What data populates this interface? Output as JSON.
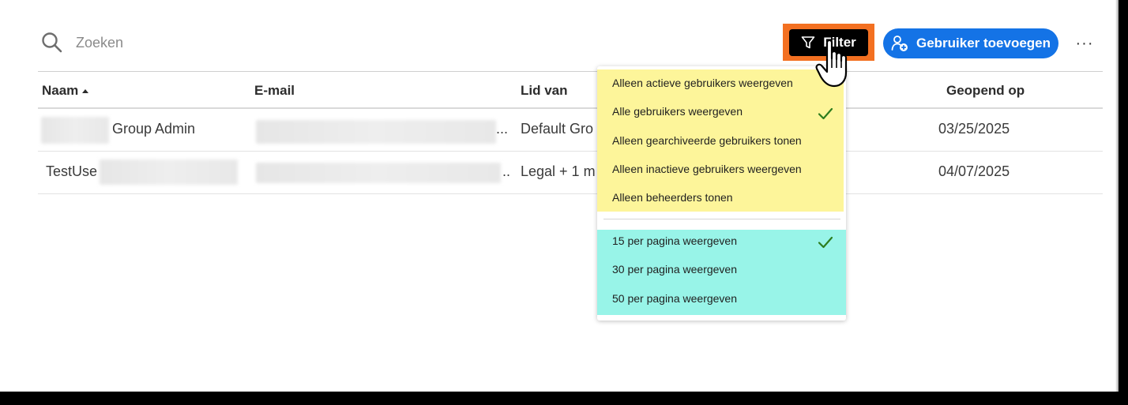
{
  "search": {
    "placeholder": "Zoeken"
  },
  "toolbar": {
    "filter_label": "Filter",
    "add_user_label": "Gebruiker toevoegen",
    "more_label": "···"
  },
  "table": {
    "columns": [
      "Naam",
      "E-mail",
      "Lid van",
      "Geopend op"
    ],
    "rows": [
      {
        "name": "Group Admin",
        "email_suffix": "...",
        "member_of": "Default Gro",
        "opened_on": "03/25/2025"
      },
      {
        "name": "TestUse",
        "email_suffix": "..",
        "member_of": "Legal + 1 m",
        "opened_on": "04/07/2025"
      }
    ]
  },
  "filter_menu": {
    "visibility_options": [
      {
        "label": "Alleen actieve gebruikers weergeven",
        "checked": false
      },
      {
        "label": "Alle gebruikers weergeven",
        "checked": true
      },
      {
        "label": "Alleen gearchiveerde gebruikers tonen",
        "checked": false
      },
      {
        "label": "Alleen inactieve gebruikers weergeven",
        "checked": false
      },
      {
        "label": "Alleen beheerders tonen",
        "checked": false
      }
    ],
    "page_size_options": [
      {
        "label": "15 per pagina weergeven",
        "checked": true
      },
      {
        "label": "30 per pagina weergeven",
        "checked": false
      },
      {
        "label": "50 per pagina weergeven",
        "checked": false
      }
    ]
  },
  "colors": {
    "primary_button": "#1473e6",
    "filter_button": "#000000",
    "highlight_orange": "#f37021",
    "highlight_yellow": "#fdf59a",
    "highlight_cyan": "#98f4e8",
    "check_green": "#2d7d1e"
  },
  "icons": [
    "search-icon",
    "filter-icon",
    "add-user-icon",
    "more-icon",
    "sort-ascending-icon",
    "checkmark-icon",
    "hand-cursor-icon"
  ]
}
